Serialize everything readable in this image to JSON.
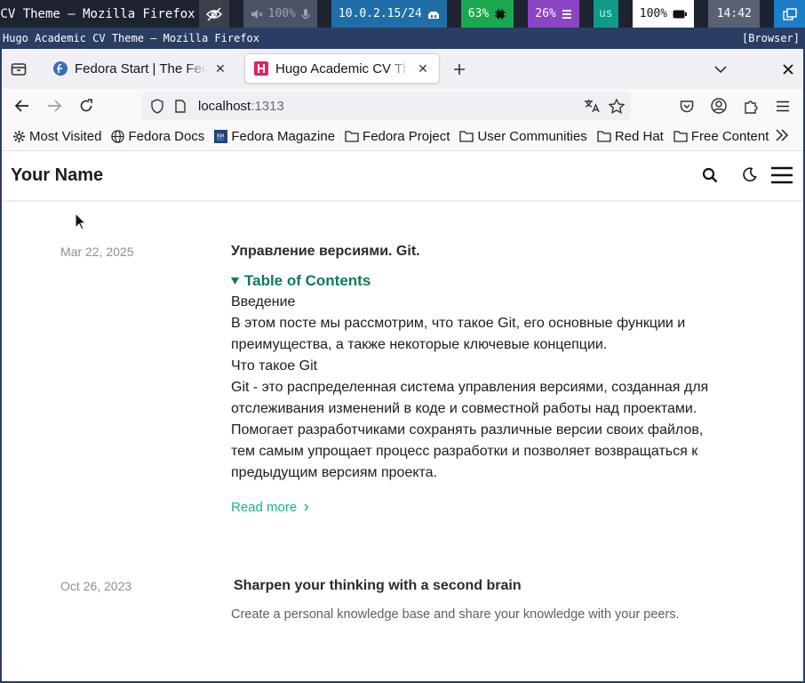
{
  "statusbar": {
    "window_title": "Hugo Academic CV Theme — Mozilla Firefox",
    "volume": "100%",
    "network": "10.0.2.15/24",
    "cpu": "63%",
    "memory": "26%",
    "keyboard": "us",
    "battery": "100%",
    "clock": "14:42"
  },
  "window": {
    "title": "Hugo Academic CV Theme — Mozilla Firefox",
    "tag": "[Browser]"
  },
  "tabs": [
    {
      "label": "Fedora Start | The Fedora Project",
      "active": false
    },
    {
      "label": "Hugo Academic CV Theme",
      "active": true
    }
  ],
  "urlbar": {
    "host": "localhost",
    "port": ":1313"
  },
  "bookmarks": [
    {
      "label": "Most Visited",
      "icon": "gear-icon"
    },
    {
      "label": "Fedora Docs",
      "icon": "globe-icon"
    },
    {
      "label": "Fedora Magazine",
      "icon": "fm-icon"
    },
    {
      "label": "Fedora Project",
      "icon": "folder-icon"
    },
    {
      "label": "User Communities",
      "icon": "folder-icon"
    },
    {
      "label": "Red Hat",
      "icon": "folder-icon"
    },
    {
      "label": "Free Content",
      "icon": "folder-icon"
    }
  ],
  "site": {
    "brand": "Your Name",
    "read_more": "Read more",
    "posts": [
      {
        "date": "Mar 22, 2025",
        "title": "Управление версиями. Git.",
        "toc_label": "Table of Contents",
        "lines": [
          "Введение",
          "В этом посте мы рассмотрим, что такое Git, его основные функции и",
          "преимущества, а также некоторые ключевые концепции.",
          "Что такое Git",
          "Git - это распределенная система управления версиями, созданная для",
          "отслеживания изменений в коде и совместной работы над проектами.",
          "Помогает разработчиками сохранять различные версии своих файлов,",
          "тем самым упрощает процесс разработки и позволяет возвращаться к",
          "предыдущим версиям проекта."
        ]
      },
      {
        "date": "Oct 26, 2023",
        "title": "Sharpen your thinking with a second brain",
        "summary": "Create a personal knowledge base and share your knowledge with your peers."
      }
    ]
  },
  "colors": {
    "accent_green": "#18b57f",
    "toc_green": "#0f7a5c",
    "bar_bg": "#1d2330"
  }
}
